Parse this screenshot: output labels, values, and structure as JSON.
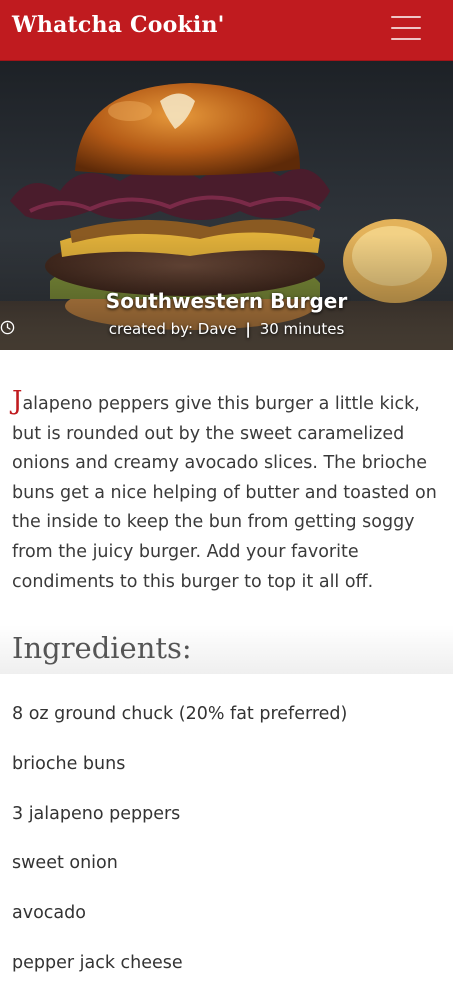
{
  "app": {
    "brand": "Whatcha Cookin'",
    "menu_icon": "hamburger-menu-icon",
    "accent_color": "#c01b1f"
  },
  "recipe": {
    "title": "Southwestern Burger",
    "author_label": "created by:",
    "author": "Dave",
    "separator": "|",
    "time_icon": "clock-icon",
    "time": "30 minutes",
    "description_first_letter": "J",
    "description_rest": "alapeno peppers give this burger a little kick, but is rounded out by the sweet caramelized onions and creamy avocado slices. The brioche buns get a nice helping of butter and toasted on the inside to keep the bun from getting soggy from the juicy burger. Add your favorite condiments to this burger to top it all off."
  },
  "ingredients": {
    "heading": "Ingredients:",
    "items": [
      "8 oz ground chuck (20% fat preferred)",
      "brioche buns",
      "3 jalapeno peppers",
      "sweet onion",
      "avocado",
      "pepper jack cheese"
    ]
  }
}
